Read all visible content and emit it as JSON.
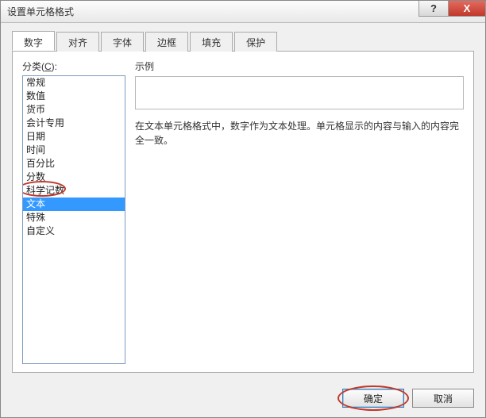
{
  "window": {
    "title": "设置单元格格式",
    "help_glyph": "?",
    "close_glyph": "X"
  },
  "tabs": [
    {
      "label": "数字",
      "active": true
    },
    {
      "label": "对齐",
      "active": false
    },
    {
      "label": "字体",
      "active": false
    },
    {
      "label": "边框",
      "active": false
    },
    {
      "label": "填充",
      "active": false
    },
    {
      "label": "保护",
      "active": false
    }
  ],
  "number_tab": {
    "category_label_pre": "分类(",
    "category_label_hot": "C",
    "category_label_post": "):",
    "categories": [
      "常规",
      "数值",
      "货币",
      "会计专用",
      "日期",
      "时间",
      "百分比",
      "分数",
      "科学记数",
      "文本",
      "特殊",
      "自定义"
    ],
    "selected_index": 9,
    "sample_label": "示例",
    "sample_value": "",
    "description": "在文本单元格格式中，数字作为文本处理。单元格显示的内容与输入的内容完全一致。"
  },
  "buttons": {
    "ok": "确定",
    "cancel": "取消"
  },
  "annotations": {
    "highlight_category": true,
    "highlight_ok": true
  }
}
